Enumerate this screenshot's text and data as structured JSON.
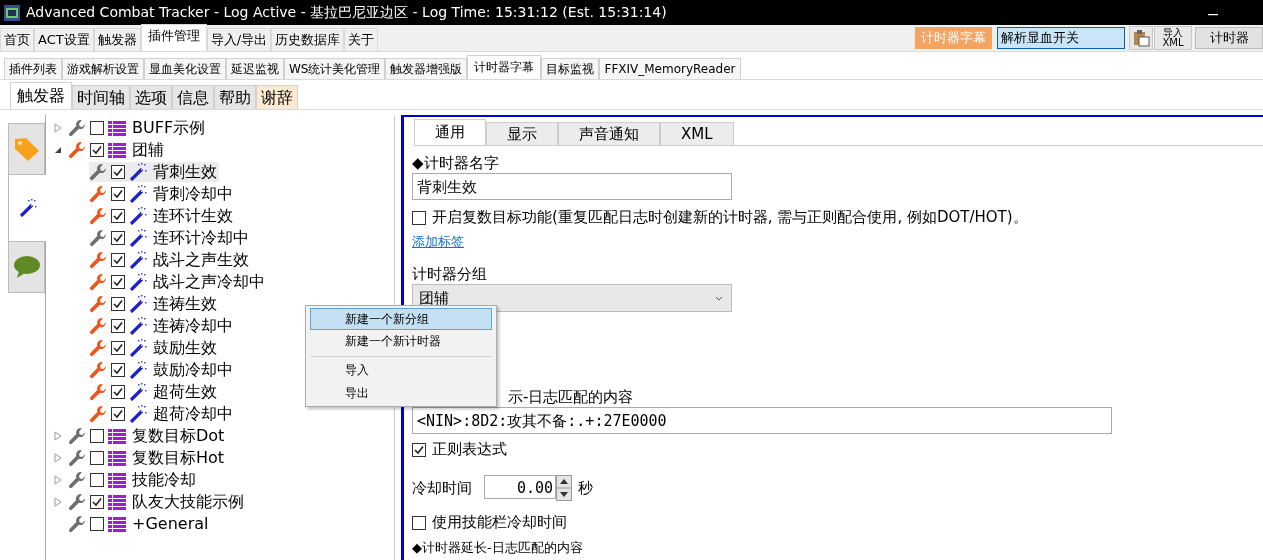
{
  "window": {
    "title": "Advanced Combat Tracker - Log Active - 基拉巴尼亚边区 - Log Time: 15:31:12 (Est. 15:31:14)"
  },
  "main_tabs": [
    {
      "label": "首页",
      "selected": false
    },
    {
      "label": "ACT设置",
      "selected": false
    },
    {
      "label": "触发器",
      "selected": false
    },
    {
      "label": "插件管理",
      "selected": true
    },
    {
      "label": "导入/导出",
      "selected": false
    },
    {
      "label": "历史数据库",
      "selected": false
    },
    {
      "label": "关于",
      "selected": false
    }
  ],
  "toolbar": {
    "status_label": "计时器字幕",
    "search_value": "解析显血开关",
    "xml_button": {
      "top": "导入",
      "bottom": "XML"
    },
    "timer_button": "计时器"
  },
  "plugin_tabs": [
    {
      "label": "插件列表",
      "selected": false
    },
    {
      "label": "游戏解析设置",
      "selected": false
    },
    {
      "label": "显血美化设置",
      "selected": false
    },
    {
      "label": "延迟监视",
      "selected": false
    },
    {
      "label": "WS统计美化管理",
      "selected": false
    },
    {
      "label": "触发器增强版",
      "selected": false
    },
    {
      "label": "计时器字幕",
      "selected": true
    },
    {
      "label": "目标监视",
      "selected": false
    },
    {
      "label": "FFXIV_MemoryReader",
      "selected": false
    }
  ],
  "sub_tabs": [
    {
      "label": "触发器",
      "selected": true,
      "highlighted": false
    },
    {
      "label": "时间轴",
      "selected": false,
      "highlighted": false
    },
    {
      "label": "选项",
      "selected": false,
      "highlighted": false
    },
    {
      "label": "信息",
      "selected": false,
      "highlighted": false
    },
    {
      "label": "帮助",
      "selected": false,
      "highlighted": false
    },
    {
      "label": "谢辞",
      "selected": false,
      "highlighted": true
    }
  ],
  "side_tabs": [
    {
      "kind": "tag",
      "selected": false
    },
    {
      "kind": "wand",
      "selected": true
    },
    {
      "kind": "chat",
      "selected": false
    }
  ],
  "tree": [
    {
      "label": "BUFF示例",
      "kind": "group",
      "expanded": false,
      "active": false,
      "checked": false,
      "selected": false
    },
    {
      "label": "团辅",
      "kind": "group",
      "expanded": true,
      "active": true,
      "checked": true,
      "selected": false,
      "children": [
        {
          "label": "背刺生效",
          "kind": "timer",
          "active": false,
          "checked": true,
          "selected": true
        },
        {
          "label": "背刺冷却中",
          "kind": "timer",
          "active": true,
          "checked": true,
          "selected": false
        },
        {
          "label": "连环计生效",
          "kind": "timer",
          "active": true,
          "checked": true,
          "selected": false
        },
        {
          "label": "连环计冷却中",
          "kind": "timer",
          "active": false,
          "checked": true,
          "selected": false
        },
        {
          "label": "战斗之声生效",
          "kind": "timer",
          "active": true,
          "checked": true,
          "selected": false
        },
        {
          "label": "战斗之声冷却中",
          "kind": "timer",
          "active": true,
          "checked": true,
          "selected": false
        },
        {
          "label": "连祷生效",
          "kind": "timer",
          "active": true,
          "checked": true,
          "selected": false
        },
        {
          "label": "连祷冷却中",
          "kind": "timer",
          "active": true,
          "checked": true,
          "selected": false
        },
        {
          "label": "鼓励生效",
          "kind": "timer",
          "active": true,
          "checked": true,
          "selected": false
        },
        {
          "label": "鼓励冷却中",
          "kind": "timer",
          "active": true,
          "checked": true,
          "selected": false
        },
        {
          "label": "超荷生效",
          "kind": "timer",
          "active": true,
          "checked": true,
          "selected": false
        },
        {
          "label": "超荷冷却中",
          "kind": "timer",
          "active": true,
          "checked": true,
          "selected": false
        }
      ]
    },
    {
      "label": "复数目标Dot",
      "kind": "group",
      "expanded": false,
      "active": false,
      "checked": false,
      "selected": false
    },
    {
      "label": "复数目标Hot",
      "kind": "group",
      "expanded": false,
      "active": false,
      "checked": false,
      "selected": false
    },
    {
      "label": "技能冷却",
      "kind": "group",
      "expanded": false,
      "active": false,
      "checked": false,
      "selected": false
    },
    {
      "label": "队友大技能示例",
      "kind": "group",
      "expanded": false,
      "active": false,
      "checked": true,
      "selected": false
    },
    {
      "label": "+General",
      "kind": "group",
      "active": false,
      "checked": false,
      "selected": false
    }
  ],
  "editor": {
    "tabs": [
      {
        "label": "通用",
        "selected": true
      },
      {
        "label": "显示",
        "selected": false
      },
      {
        "label": "声音通知",
        "selected": false
      },
      {
        "label": "XML",
        "selected": false
      }
    ],
    "name_label": "◆计时器名字",
    "name_value": "背刺生效",
    "multi_target": {
      "label": "开启复数目标功能(重复匹配日志时创建新的计时器, 需与正则配合使用, 例如DOT/HOT)。",
      "checked": false
    },
    "add_tag_link": "添加标签",
    "group_label": "计时器分组",
    "group_value": "团辅",
    "match_label": "示-日志匹配的内容",
    "match_value": "<NIN>:8D2:攻其不备:.+:27E0000",
    "regex": {
      "label": "正则表达式",
      "checked": true
    },
    "cooldown_label": "冷却时间",
    "cooldown_value": "0.00",
    "cooldown_unit": "秒",
    "skillbar": {
      "label": "使用技能栏冷却时间",
      "checked": false
    },
    "extend_label": "◆计时器延长-日志匹配的内容"
  },
  "context_menu": {
    "items": [
      {
        "label": "新建一个新分组",
        "selected": true,
        "separator_before": false
      },
      {
        "label": "新建一个新计时器",
        "selected": false,
        "separator_before": false
      },
      {
        "label": "导入",
        "selected": false,
        "separator_before": true
      },
      {
        "label": "导出",
        "selected": false,
        "separator_before": false
      }
    ]
  }
}
